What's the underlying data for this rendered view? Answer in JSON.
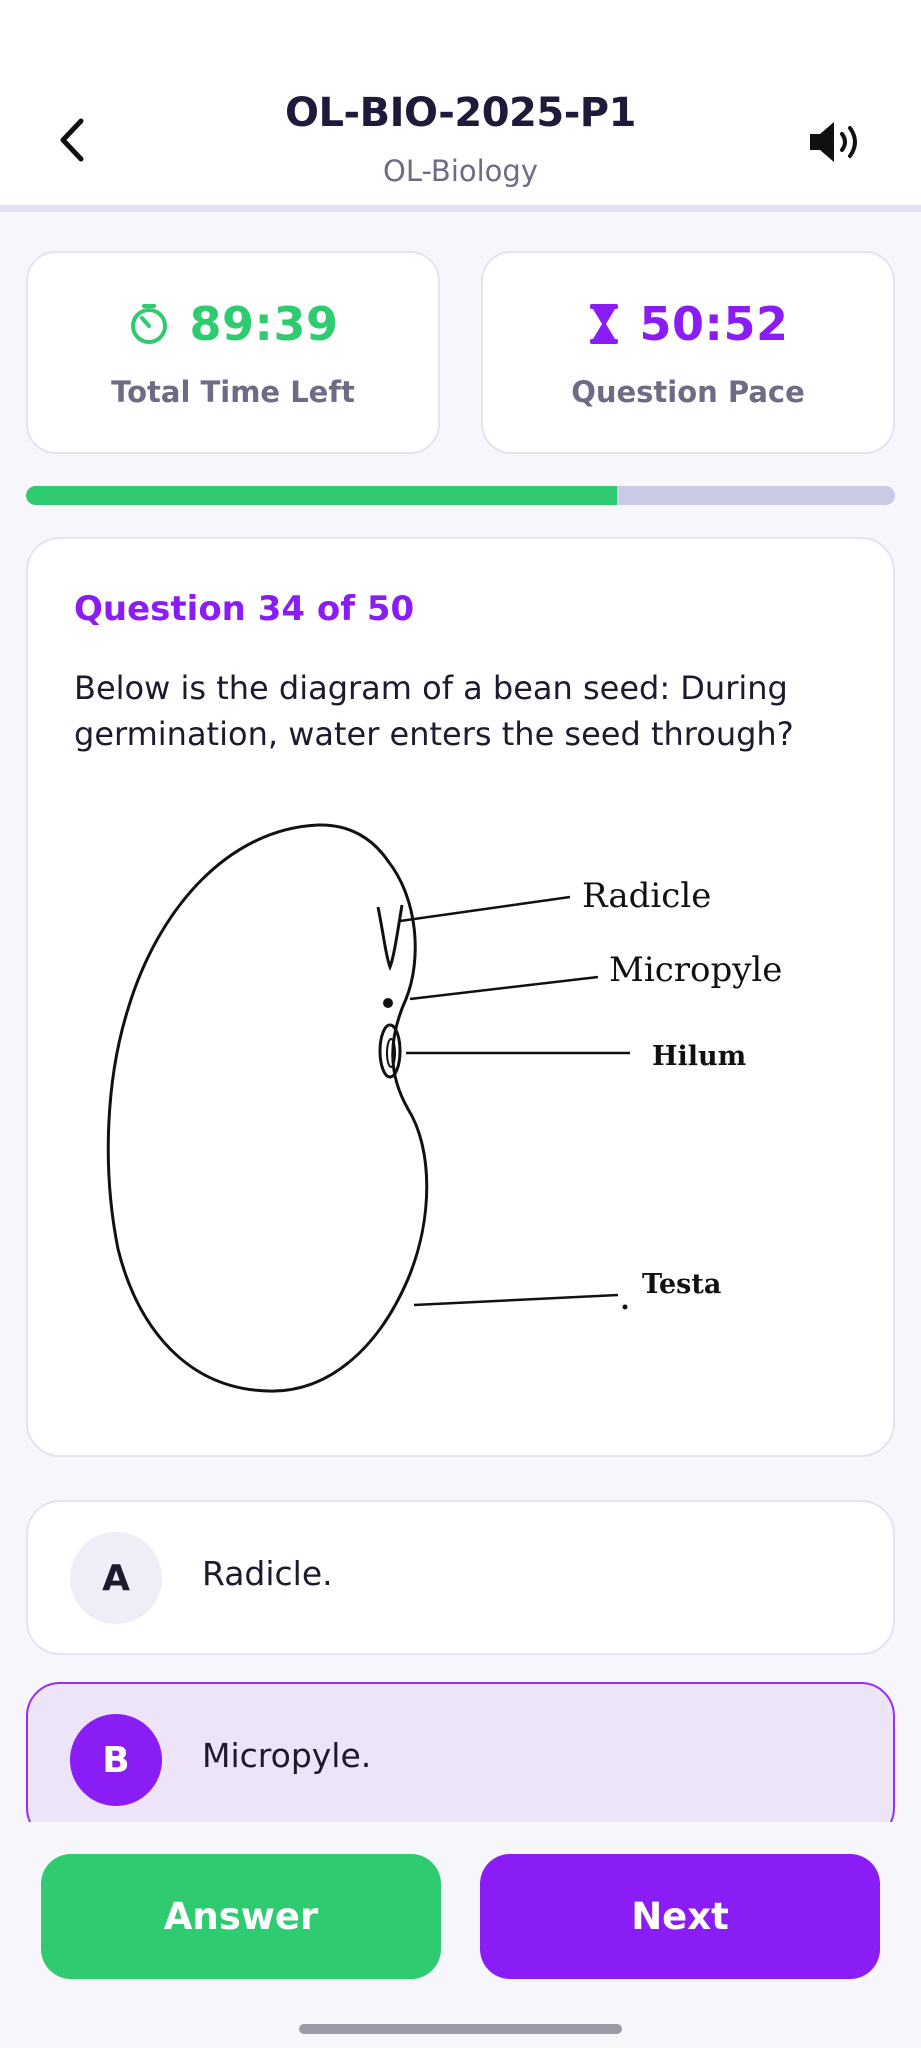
{
  "header": {
    "title": "OL-BIO-2025-P1",
    "subtitle": "OL-Biology",
    "back_icon": "chevron-left-icon",
    "sound_icon": "speaker-icon"
  },
  "timers": {
    "total": {
      "value": "89:39",
      "label": "Total Time Left",
      "icon": "stopwatch-icon",
      "color": "#2ecb70"
    },
    "pace": {
      "value": "50:52",
      "label": "Question Pace",
      "icon": "hourglass-icon",
      "color": "#8a1cf6"
    }
  },
  "progress": {
    "fraction": 0.68,
    "fill_color": "#2ecb70",
    "track_color": "#c9cbe6"
  },
  "question": {
    "number_label": "Question 34 of 50",
    "text": "Below is the diagram of a bean seed: During germination, water enters the seed through?",
    "diagram": {
      "labels": {
        "radicle": "Radicle",
        "micropyle": "Micropyle",
        "hilum": "Hilum",
        "testa": "Testa"
      }
    }
  },
  "options": [
    {
      "letter": "A",
      "text": "Radicle.",
      "selected": false
    },
    {
      "letter": "B",
      "text": "Micropyle.",
      "selected": true
    }
  ],
  "actions": {
    "answer_label": "Answer",
    "next_label": "Next"
  },
  "colors": {
    "accent_purple": "#8a1cf6",
    "accent_green": "#2ecb70"
  }
}
